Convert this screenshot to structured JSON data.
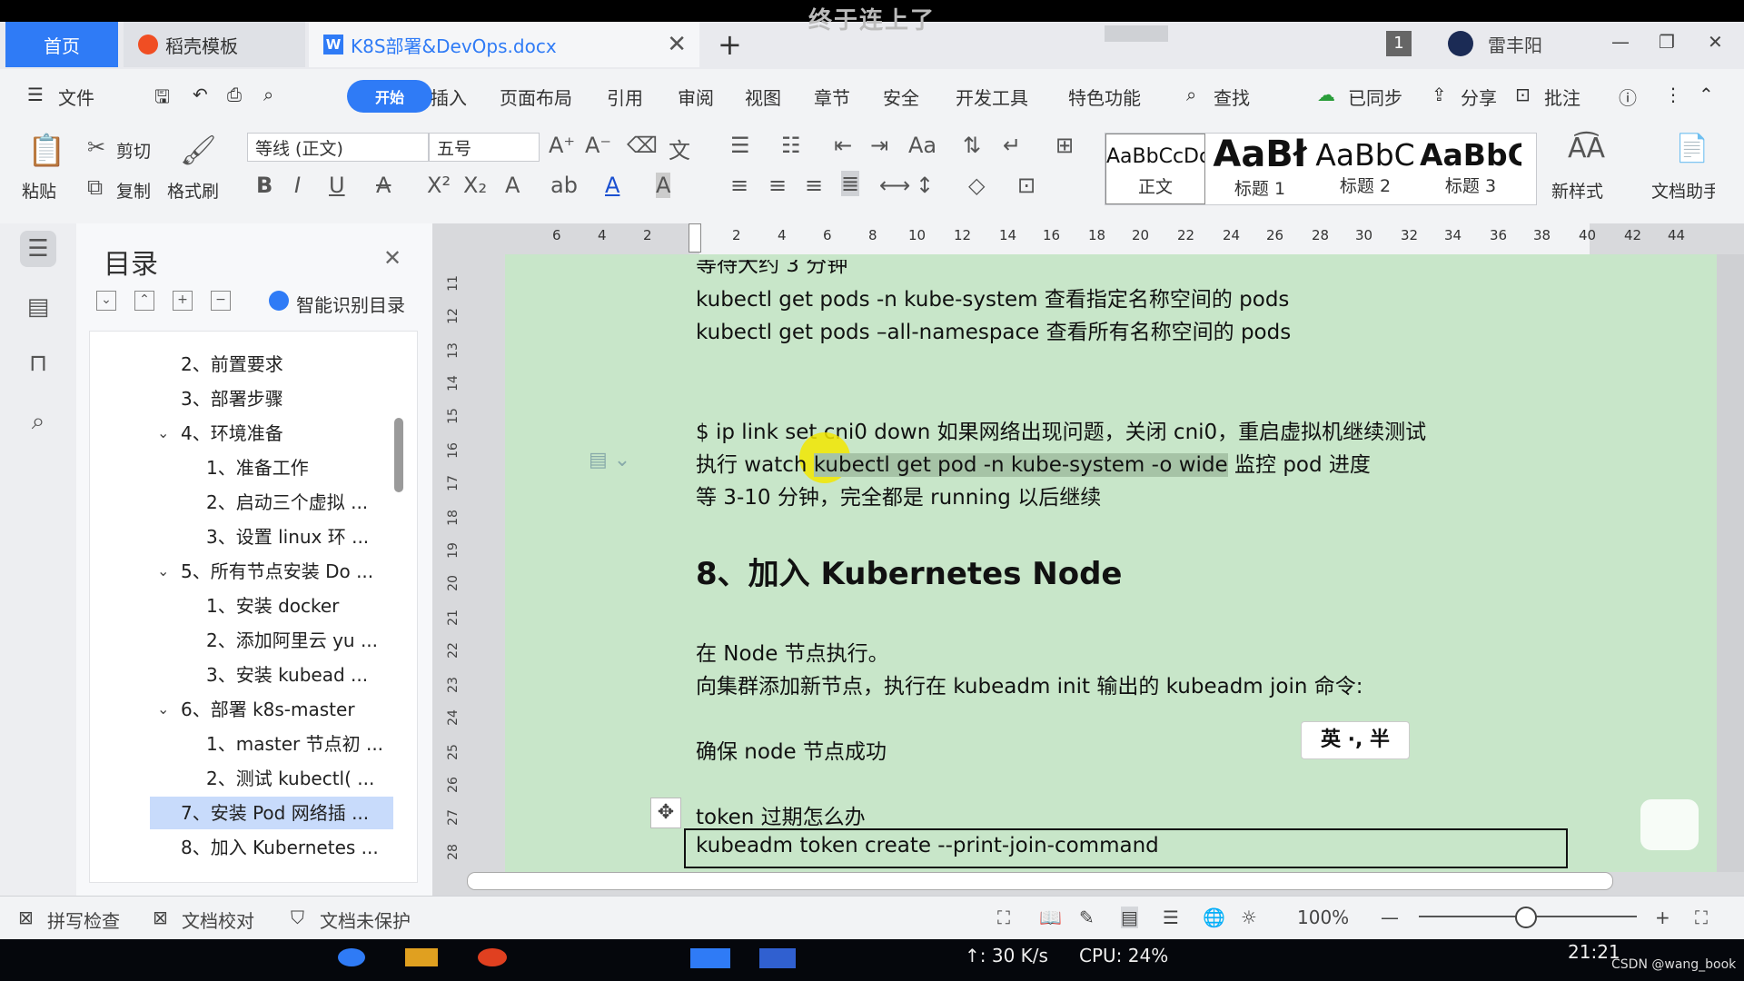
{
  "overlay_caption": "终于连上了",
  "tabs": {
    "home": "首页",
    "template": "稻壳模板",
    "document": "K8S部署&DevOps.docx",
    "page_badge": "1",
    "user": "雷丰阳"
  },
  "menu": [
    "文件",
    "开始",
    "插入",
    "页面布局",
    "引用",
    "审阅",
    "视图",
    "章节",
    "安全",
    "开发工具",
    "特色功能",
    "查找",
    "已同步",
    "分享",
    "批注"
  ],
  "ribbon": {
    "paste": "粘贴",
    "cut": "剪切",
    "copy": "复制",
    "format_painter": "格式刷",
    "font_name": "等线 (正文)",
    "font_size": "五号",
    "new_style": "新样式",
    "doc_assistant": "文档助手",
    "styles": [
      {
        "preview": "AaBbCcDc",
        "name": "正文"
      },
      {
        "preview": "AaBł",
        "name": "标题 1"
      },
      {
        "preview": "AaBbC",
        "name": "标题 2"
      },
      {
        "preview": "AaBbC",
        "name": "标题 3"
      }
    ]
  },
  "toc": {
    "title": "目录",
    "smart_recognize": "智能识别目录",
    "items": [
      {
        "label": "2、前置要求",
        "level": 1
      },
      {
        "label": "3、部署步骤",
        "level": 1
      },
      {
        "label": "4、环境准备",
        "level": 1,
        "expanded": true
      },
      {
        "label": "1、准备工作",
        "level": 2
      },
      {
        "label": "2、启动三个虚拟 ...",
        "level": 2
      },
      {
        "label": "3、设置 linux 环 ...",
        "level": 2
      },
      {
        "label": "5、所有节点安装 Do ...",
        "level": 1,
        "expanded": true
      },
      {
        "label": "1、安装 docker",
        "level": 2
      },
      {
        "label": "2、添加阿里云 yu ...",
        "level": 2
      },
      {
        "label": "3、安装 kubead ...",
        "level": 2
      },
      {
        "label": "6、部署 k8s-master",
        "level": 1,
        "expanded": true
      },
      {
        "label": "1、master 节点初 ...",
        "level": 2
      },
      {
        "label": "2、测试 kubectl( ...",
        "level": 2
      },
      {
        "label": "7、安装 Pod 网络插 ...",
        "level": 1,
        "selected": true
      },
      {
        "label": "8、加入 Kubernetes ...",
        "level": 1
      }
    ]
  },
  "ruler": {
    "h_ticks": [
      "6",
      "4",
      "2",
      "2",
      "4",
      "6",
      "8",
      "10",
      "12",
      "14",
      "16",
      "18",
      "20",
      "22",
      "24",
      "26",
      "28",
      "30",
      "32",
      "34",
      "36",
      "38",
      "40",
      "42",
      "44"
    ],
    "v_ticks": [
      "11",
      "12",
      "13",
      "14",
      "15",
      "16",
      "17",
      "18",
      "19",
      "20",
      "21",
      "22",
      "23",
      "24",
      "25",
      "26",
      "27",
      "28"
    ]
  },
  "document": {
    "partial_top": "等待大约 3 分钟",
    "line1": "kubectl get pods -n kube-system  查看指定名称空间的 pods",
    "line2": "kubectl get pods –all-namespace  查看所有名称空间的 pods",
    "line3": "$ ip link set cni0 down  如果网络出现问题，关闭 cni0，重启虚拟机继续测试",
    "line4_prefix": "执行  watch ",
    "line4_highlight": "kubectl get pod -n kube-system -o wide",
    "line4_suffix": " 监控 pod 进度",
    "line5": "等 3-10 分钟，完全都是 running 以后继续",
    "heading": "8、加入 Kubernetes Node",
    "line6": "在 Node 节点执行。",
    "line7": "向集群添加新节点，执行在 kubeadm init 输出的 kubeadm join 命令:",
    "line8": "确保 node 节点成功",
    "line9": "token 过期怎么办",
    "command": "kubeadm token create --print-join-command",
    "ime": "英 ·, 半"
  },
  "status": {
    "spell_check": "拼写检查",
    "doc_proof": "文档校对",
    "unprotected": "文档未保护",
    "zoom": "100%"
  },
  "taskbar": {
    "net_speed": "↑: 30 K/s",
    "cpu": "CPU: 24%",
    "time": "21:21",
    "watermark": "CSDN @wang_book"
  },
  "colors": {
    "accent": "#2f7bf6",
    "page_bg": "#c8e6c9",
    "highlight": "#a6c3a6",
    "toc_selected": "#c8dbfb"
  }
}
